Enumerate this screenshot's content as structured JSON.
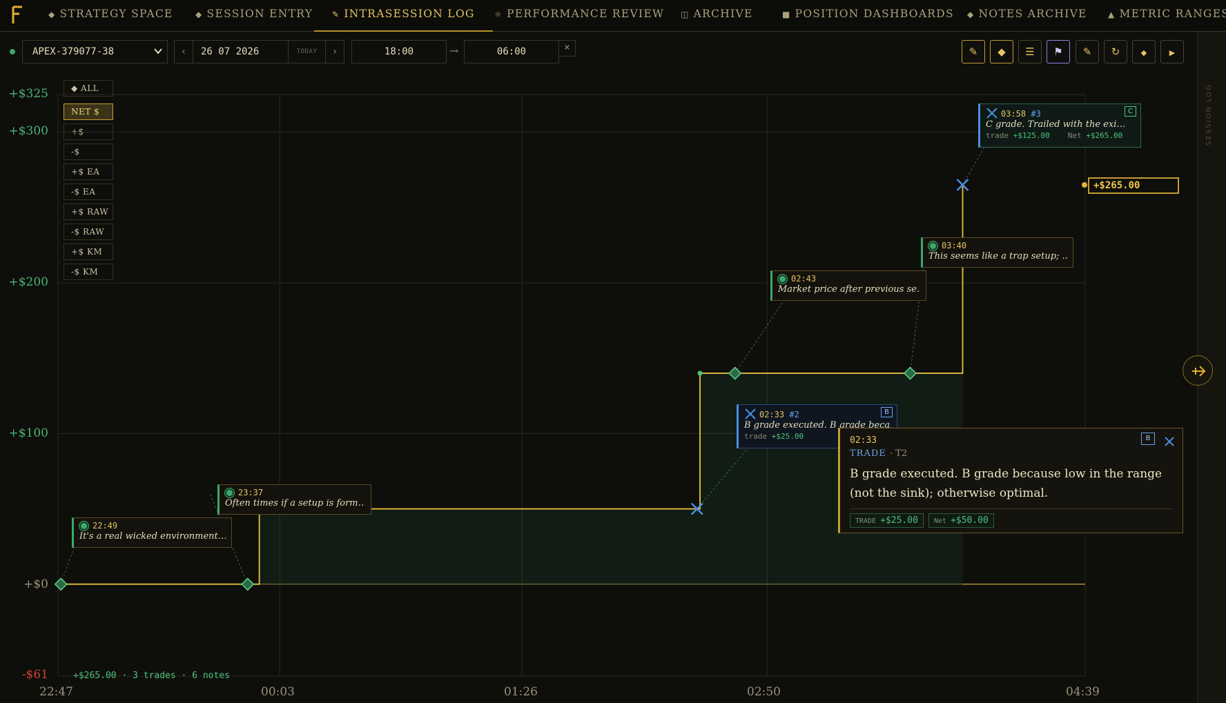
{
  "nav": {
    "tabs": [
      {
        "label": "STRATEGY SPACE",
        "icon": "◆"
      },
      {
        "label": "SESSION ENTRY",
        "icon": "◆"
      },
      {
        "label": "INTRASESSION LOG",
        "icon": "✎"
      },
      {
        "label": "PERFORMANCE REVIEW",
        "icon": "☼"
      },
      {
        "label": "ARCHIVE",
        "icon": "◫"
      },
      {
        "label": "POSITION DASHBOARDS",
        "icon": "■"
      },
      {
        "label": "NOTES ARCHIVE",
        "icon": "◆"
      },
      {
        "label": "METRIC RANGES",
        "icon": "▲"
      }
    ],
    "active_tab": "INTRASESSION LOG"
  },
  "controls": {
    "account": "APEX-379077-38",
    "prev": "‹",
    "date": "26 07 2026",
    "today": "TODAY",
    "next": "›",
    "start_time": "18:00",
    "arrow": "→",
    "end_time": "06:00",
    "clear": "×"
  },
  "toolbar": {
    "icons": [
      "pencil-icon",
      "diamond-icon",
      "list-icon",
      "flag-icon",
      "ruler-icon",
      "refresh-icon",
      "small-diamond-icon",
      "play-icon"
    ]
  },
  "legend": {
    "all": "◆ ALL",
    "items": [
      "NET $",
      "+$",
      "-$",
      "+$ EA",
      "-$ EA",
      "+$ RAW",
      "-$ RAW",
      "+$ KM",
      "-$ KM"
    ],
    "active": "NET $"
  },
  "chart_data": {
    "type": "line",
    "title": "",
    "y_ticks": [
      "+$325",
      "+$300",
      "+$200",
      "+$100",
      "+$0",
      "-$61"
    ],
    "x_ticks": [
      "22:47",
      "00:03",
      "01:26",
      "02:50",
      "04:39"
    ],
    "ylim": [
      -61,
      325
    ],
    "series": [
      {
        "points": [
          {
            "x": "22:47",
            "y": 0
          },
          {
            "x": "23:56",
            "y": 0
          },
          {
            "x": "23:56",
            "y": 50
          },
          {
            "x": "02:27",
            "y": 50
          },
          {
            "x": "02:27",
            "y": 140
          },
          {
            "x": "03:57",
            "y": 140
          },
          {
            "x": "03:57",
            "y": 265
          },
          {
            "x": "04:39",
            "y": 0
          }
        ]
      }
    ],
    "final_value": "+$265.00",
    "grid": true
  },
  "notes": [
    {
      "time": "22:49",
      "text": "It's a real wicked environment…"
    },
    {
      "time": "23:37",
      "text": "Often times if a setup is form…"
    },
    {
      "time": "02:43",
      "text": "Market price after previous se…"
    },
    {
      "time": "03:40",
      "text": "This seems like a trap setup; …"
    }
  ],
  "trades": [
    {
      "time": "02:33",
      "num": "#2",
      "grade": "B",
      "text": "B grade executed. B grade beca…",
      "trade_label": "trade",
      "trade_val": "+$25.00"
    },
    {
      "time": "03:58",
      "num": "#3",
      "grade": "C",
      "text": "C grade.  Trailed with the exi…",
      "trade_label": "trade",
      "trade_val": "+$125.00",
      "net_label": "Net",
      "net_val": "+$265.00"
    }
  ],
  "popup": {
    "time": "02:33",
    "kind": "TRADE",
    "ref": "· T2",
    "grade": "B",
    "body": "B grade executed. B grade because low in the range (not the sink); otherwise optimal.",
    "trade_label": "TRADE",
    "trade_val": "+$25.00",
    "net_label": "Net",
    "net_val": "+$50.00"
  },
  "value_tag": "+$265.00",
  "summary": "+$265.00 · 3 trades · 6 notes",
  "side_panel_label": "SESSION LOG",
  "colors": {
    "accent": "#c49d34",
    "positive": "#4bc47a",
    "negative": "#d2452f",
    "trade": "#4a8fe0"
  }
}
